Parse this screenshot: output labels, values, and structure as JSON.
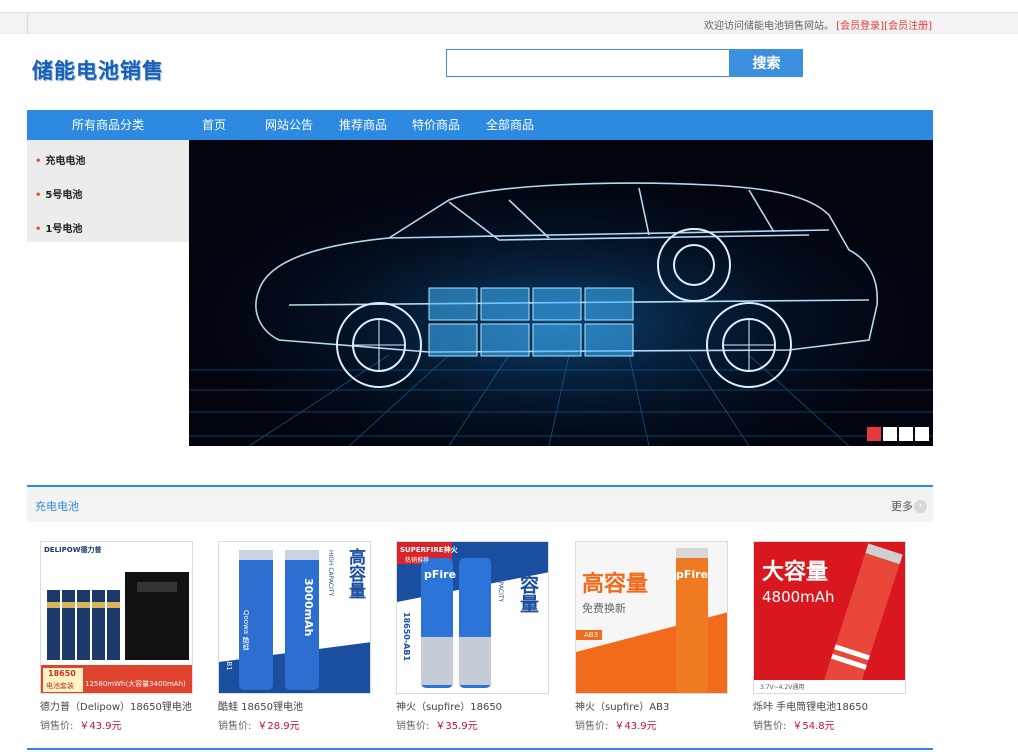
{
  "topbar": {
    "welcome": "欢迎访问储能电池销售网站。",
    "login": "[会员登录]",
    "register": "[会员注册]"
  },
  "logo": "储能电池销售",
  "search": {
    "value": "",
    "placeholder": "",
    "button": "搜索"
  },
  "nav": {
    "category_label": "所有商品分类",
    "items": [
      "首页",
      "网站公告",
      "推荐商品",
      "特价商品",
      "全部商品"
    ]
  },
  "sidebar": {
    "items": [
      "充电电池",
      "5号电池",
      "1号电池"
    ]
  },
  "banner": {
    "slides": 4,
    "active": 1
  },
  "section": {
    "title": "充电电池",
    "more": "更多"
  },
  "products": [
    {
      "name": "德力普（Delipow）18650锂电池",
      "price_label": "销售价:",
      "price": "￥43.9元",
      "thumb_text": [
        "DELIPOW德力普",
        "18650",
        "电池套装",
        "12580mWh(大容量3400mAh)"
      ]
    },
    {
      "name": "酷蛙 18650锂电池",
      "price_label": "销售价:",
      "price": "￥28.9元",
      "thumb_text": [
        "Qoowa 酷蛙",
        "3000mAh",
        "高容量",
        "HIGH CAPACITY",
        "18650-AB1"
      ]
    },
    {
      "name": "神火（supfire）18650",
      "price_label": "销售价:",
      "price": "￥35.9元",
      "thumb_text": [
        "SUPERFIRE神火",
        "热销推荐",
        "pFire",
        "高容量",
        "HIGH CAPACITY",
        "18650-AB1"
      ]
    },
    {
      "name": "神火（supfire）AB3",
      "price_label": "销售价:",
      "price": "￥43.9元",
      "thumb_text": [
        "高容量",
        "免费换新",
        "AB3",
        "pFire"
      ]
    },
    {
      "name": "烁咔 手电筒锂电池18650",
      "price_label": "销售价:",
      "price": "￥54.8元",
      "thumb_text": [
        "大容量",
        "4800mAh",
        "3.7V~4.2V通用"
      ]
    }
  ],
  "colors": {
    "accent": "#2e8ae0",
    "price": "#c8102e",
    "link": "#e4393c"
  }
}
